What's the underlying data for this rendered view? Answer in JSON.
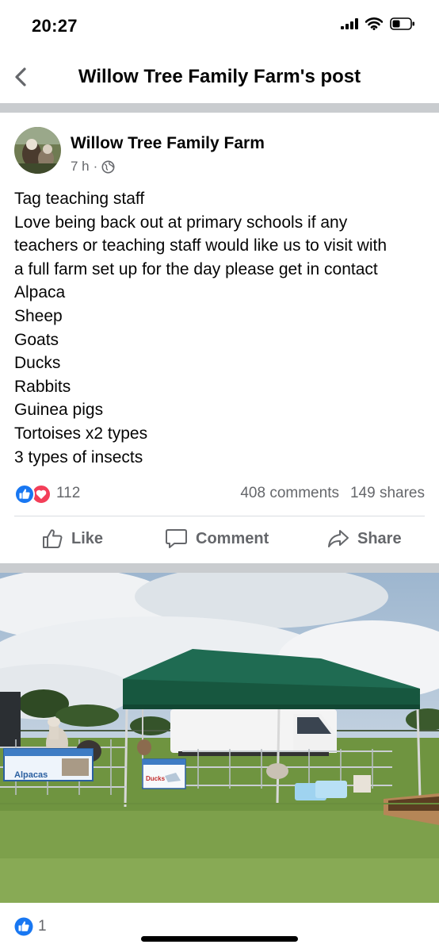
{
  "status": {
    "time": "20:27",
    "icons": [
      "signal-icon",
      "wifi-icon",
      "battery-icon"
    ]
  },
  "nav": {
    "title": "Willow Tree Family Farm's post",
    "back_icon": "chevron-left-icon"
  },
  "post": {
    "author": "Willow Tree Family Farm",
    "time": "7 h",
    "separator": "·",
    "privacy_icon": "globe-icon",
    "lines": [
      "Tag teaching staff",
      "Love being back out at primary schools if any",
      "teachers or teaching staff would like us to visit with",
      "a full farm set up for the day please get in contact",
      "Alpaca",
      "Sheep",
      "Goats",
      "Ducks",
      "Rabbits",
      "Guinea pigs",
      "Tortoises x2 types",
      "3 types of insects"
    ],
    "reactions": {
      "icons": [
        "like-reaction-icon",
        "love-reaction-icon"
      ],
      "count": "112",
      "comments": "408 comments",
      "shares": "149 shares"
    },
    "actions": {
      "like": "Like",
      "comment": "Comment",
      "share": "Share"
    },
    "photo": {
      "signs": {
        "alpacas": "Alpacas",
        "ducks": "Ducks"
      }
    },
    "photo_reactions": {
      "icon": "like-reaction-icon",
      "count": "1"
    }
  },
  "colors": {
    "like_blue": "#1877f2",
    "love_red": "#f33e58",
    "secondary_text": "#65676b",
    "divider": "#c9cccf",
    "tent_green": "#1f6b52",
    "grass": "#6f9440"
  }
}
